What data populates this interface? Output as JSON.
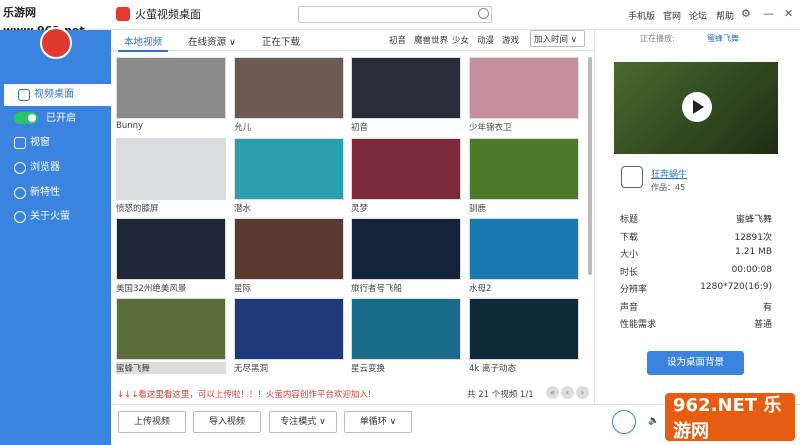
{
  "watermark": "乐游网 www.962.net",
  "app": {
    "title": "火萤视频桌面"
  },
  "search": {
    "placeholder": ""
  },
  "topmenu": [
    "手机版",
    "官网",
    "论坛",
    "帮助"
  ],
  "sidebar": {
    "items": [
      "视频桌面",
      "已开启",
      "视窗",
      "浏览器",
      "新特性",
      "关于火萤"
    ]
  },
  "tabs": [
    "本地视频",
    "在线资源 ∨",
    "正在下载"
  ],
  "categories": [
    "初音",
    "魔兽世界",
    "少女",
    "动漫",
    "游戏"
  ],
  "sort": "加入时间 ∨",
  "grid": [
    {
      "label": "Bunny",
      "color": "#8a8a8a"
    },
    {
      "label": "允儿",
      "color": "#6b5a52"
    },
    {
      "label": "初音",
      "color": "#2a2c3a"
    },
    {
      "label": "少年锦衣卫",
      "color": "#c88fa0"
    },
    {
      "label": "愤怒的膝屏",
      "color": "#d8dde0"
    },
    {
      "label": "潜水",
      "color": "#2a9fb0"
    },
    {
      "label": "灵梦",
      "color": "#7a2a38"
    },
    {
      "label": "驯鹿",
      "color": "#4a7a2a"
    },
    {
      "label": "美国32州绝美风景",
      "color": "#1e2838"
    },
    {
      "label": "星际",
      "color": "#5a3a30"
    },
    {
      "label": "旅行者号飞船",
      "color": "#14223a"
    },
    {
      "label": "水母2",
      "color": "#1a7ab0"
    },
    {
      "label": "蜜蜂飞舞",
      "color": "#5a6e3a"
    },
    {
      "label": "无尽黑洞",
      "color": "#1e3a7a"
    },
    {
      "label": "星云变换",
      "color": "#1a6a8a"
    },
    {
      "label": "4k 离子动态",
      "color": "#0e2a3a"
    }
  ],
  "marquee": "↓↓↓看这里看这里，可以上传啦！！！火萤内容创作平台欢迎加入!",
  "count": "共 21 个视频  1/1",
  "bottom": {
    "buttons": [
      "上传视频",
      "导入视频",
      "专注模式 ∨",
      "单循环 ∨"
    ]
  },
  "right": {
    "nowplaying": "正在播放:",
    "nowplaying_name": "蜜蜂飞舞",
    "author": "狂奔蜗牛",
    "works": "作品：45",
    "props": [
      {
        "k": "标题",
        "v": "蜜蜂飞舞"
      },
      {
        "k": "下载",
        "v": "12891次"
      },
      {
        "k": "大小",
        "v": "1.21 MB"
      },
      {
        "k": "时长",
        "v": "00:00:08"
      },
      {
        "k": "分辨率",
        "v": "1280*720(16:9)"
      },
      {
        "k": "声音",
        "v": "有"
      },
      {
        "k": "性能需求",
        "v": "普通"
      }
    ],
    "setbg": "设为桌面背景"
  },
  "logo962": "962.NET 乐游网"
}
